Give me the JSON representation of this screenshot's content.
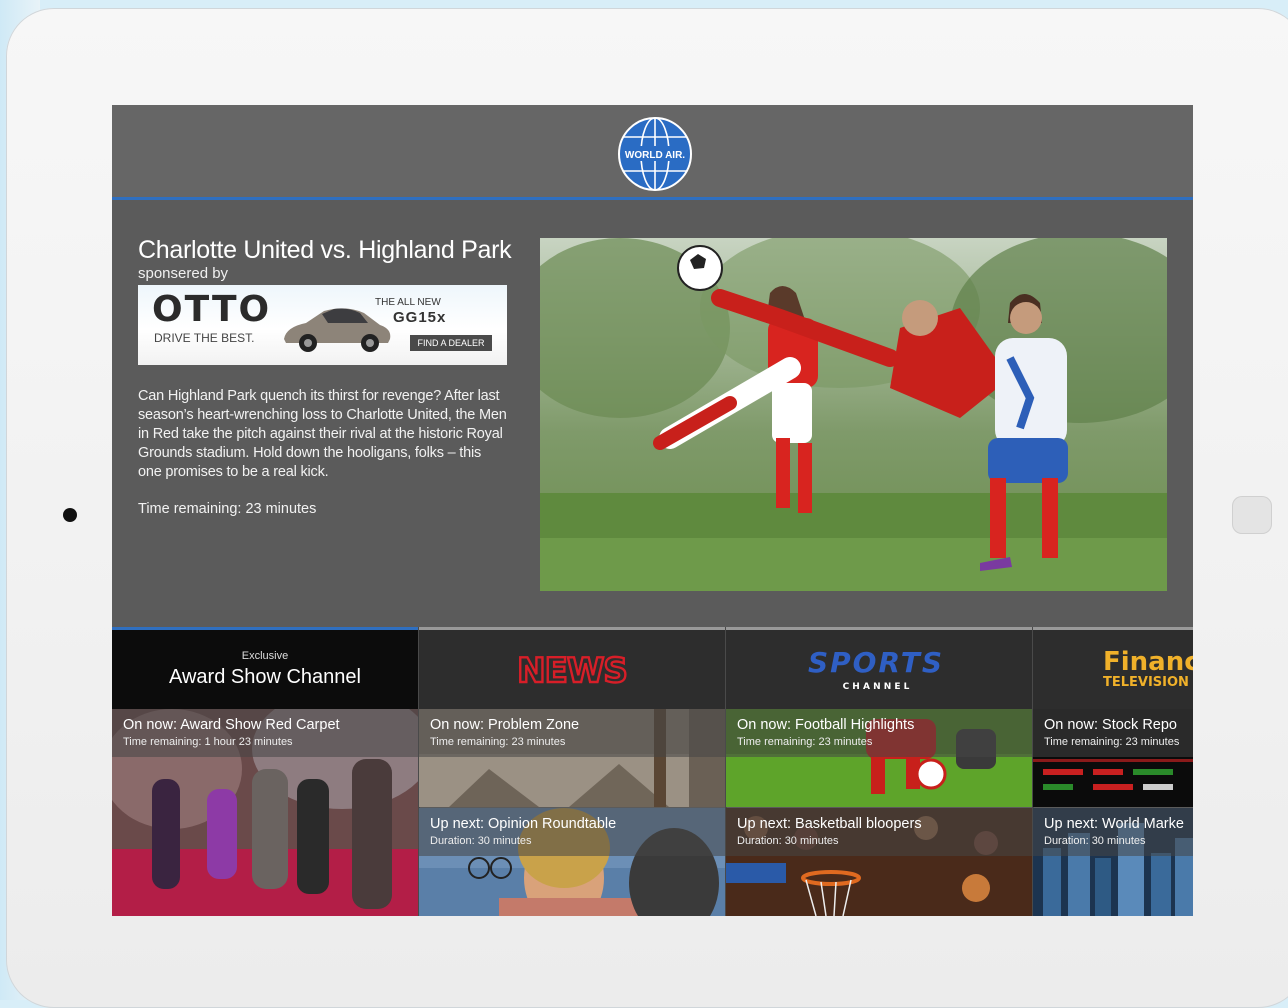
{
  "brand": {
    "logo_text": "WORLD AIR.",
    "accent": "#2f6fc0"
  },
  "featured": {
    "title": "Charlotte United vs. Highland Park",
    "sponsor_label": "sponsered by",
    "description": "Can Highland Park quench its thirst for revenge? After last season’s heart-wrenching loss to Charlotte United, the Men in Red take the pitch against their rival at the historic Royal Grounds stadium. Hold down the hooligans, folks – this one promises to be a real kick.",
    "time_remaining": "Time remaining: 23 minutes"
  },
  "ad": {
    "brand": "OTTO",
    "tagline": "DRIVE THE BEST.",
    "headline": "THE ALL NEW",
    "model": "GG15x",
    "cta": "FIND A DEALER"
  },
  "channels": [
    {
      "id": "award",
      "exclusive_label": "Exclusive",
      "name": "Award Show Channel",
      "now_title": "On now: Award Show Red Carpet",
      "now_sub": "Time remaining: 1 hour 23 minutes"
    },
    {
      "id": "news",
      "logo_text": "NEWS",
      "now_title": "On now: Problem Zone",
      "now_sub": "Time remaining: 23 minutes",
      "next_title": "Up next: Opinion Roundtable",
      "next_sub": "Duration: 30 minutes"
    },
    {
      "id": "sports",
      "logo_text": "SPORTS",
      "logo_sub": "C H A N N E L",
      "now_title": "On now: Football Highlights",
      "now_sub": "Time remaining: 23 minutes",
      "next_title": "Up next: Basketball bloopers",
      "next_sub": "Duration: 30 minutes"
    },
    {
      "id": "finance",
      "logo_text": "Financi",
      "logo_sub": "TELEVISION",
      "now_title": "On now: Stock Repo",
      "now_sub": "Time remaining: 23 minutes",
      "next_title": "Up next: World Marke",
      "next_sub": "Duration: 30 minutes"
    }
  ]
}
